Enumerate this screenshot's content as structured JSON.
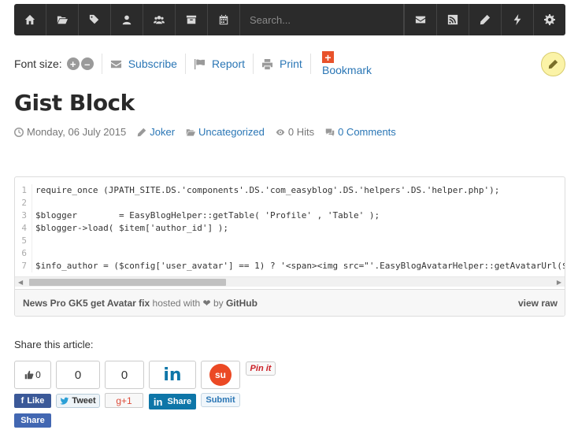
{
  "toolbar": {
    "search_placeholder": "Search...",
    "left_icons": [
      "home-icon",
      "folder-open-icon",
      "tags-icon",
      "user-icon",
      "users-icon",
      "archive-icon",
      "calendar-icon"
    ],
    "right_icons": [
      "envelope-icon",
      "rss-icon",
      "pencil-icon",
      "bolt-icon",
      "gear-icon"
    ]
  },
  "tools": {
    "font_size_label": "Font size:",
    "increase": "+",
    "decrease": "–",
    "subscribe": "Subscribe",
    "report": "Report",
    "print": "Print",
    "bookmark": "Bookmark",
    "bookmark_icon_text": "+"
  },
  "article": {
    "title": "Gist Block",
    "date": "Monday, 06 July 2015",
    "author": "Joker",
    "category": "Uncategorized",
    "hits": "0 Hits",
    "comments": "0 Comments"
  },
  "gist": {
    "lines": [
      {
        "n": "1",
        "code": "require_once (JPATH_SITE.DS.'components'.DS.'com_easyblog'.DS.'helpers'.DS.'helper.php');"
      },
      {
        "n": "2",
        "code": ""
      },
      {
        "n": "3",
        "code": "$blogger        = EasyBlogHelper::getTable( 'Profile' , 'Table' );"
      },
      {
        "n": "4",
        "code": "$blogger->load( $item['author_id'] );"
      },
      {
        "n": "5",
        "code": ""
      },
      {
        "n": "6",
        "code": ""
      },
      {
        "n": "7",
        "code": "$info_author = ($config['user_avatar'] == 1) ? '<span><img src=\"'.EasyBlogAvatarHelper::getAvatarUrl($"
      }
    ],
    "footer_file": "News Pro GK5 get Avatar fix",
    "footer_hosted": "hosted with ❤ by",
    "footer_github": "GitHub",
    "view_raw": "view raw"
  },
  "share": {
    "label": "Share this article:",
    "facebook_count": "0",
    "facebook_like": "Like",
    "facebook_share": "Share",
    "twitter_count": "0",
    "twitter_label": "Tweet",
    "gplus_count": "0",
    "gplus_label": "g+1",
    "linkedin_logo": "in",
    "linkedin_label": "Share",
    "stumble_logo": "su",
    "stumble_label": "Submit",
    "pinterest_label": "Pin it"
  },
  "colors": {
    "toolbar_bg": "#2b2b2b",
    "link": "#2a76b5",
    "bookmark_icon": "#e8522b",
    "facebook": "#3b5998",
    "linkedin": "#0e76a8",
    "stumbleupon": "#eb4924",
    "pinterest": "#cb2027"
  }
}
